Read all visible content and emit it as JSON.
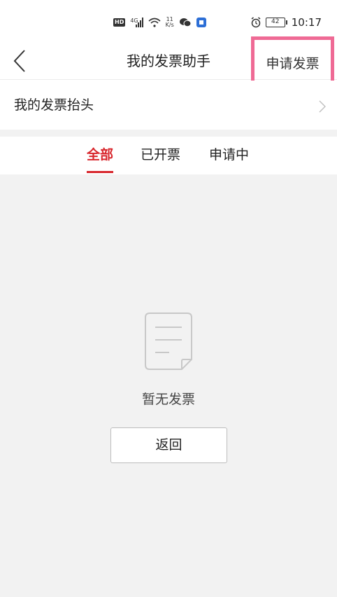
{
  "status_bar": {
    "hd": "HD",
    "network": "4G",
    "speed_value": "11",
    "speed_unit": "K/s",
    "battery": "42",
    "time": "10:17"
  },
  "header": {
    "title": "我的发票助手",
    "apply_label": "申请发票"
  },
  "invoice_title_row": {
    "label": "我的发票抬头"
  },
  "tabs": [
    {
      "label": "全部",
      "active": true
    },
    {
      "label": "已开票",
      "active": false
    },
    {
      "label": "申请中",
      "active": false
    }
  ],
  "empty_state": {
    "message": "暂无发票",
    "button_label": "返回"
  },
  "colors": {
    "accent": "#d8262c",
    "highlight_border": "#ef6a95",
    "background": "#f2f2f2"
  }
}
